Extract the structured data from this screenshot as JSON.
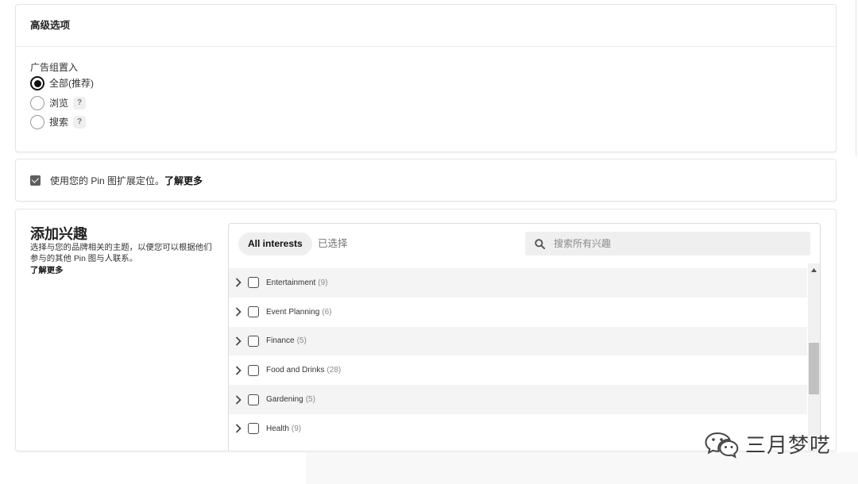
{
  "advanced_options": {
    "title": "高级选项",
    "placement": {
      "label": "广告组置入",
      "options": [
        {
          "label": "全部(推荐)",
          "selected": true
        },
        {
          "label": "浏览",
          "selected": false,
          "help": "?"
        },
        {
          "label": "搜索",
          "selected": false,
          "help": "?"
        }
      ]
    }
  },
  "expanded_targeting": {
    "checked": true,
    "text": "使用您的 Pin 图扩展定位。",
    "link": "了解更多"
  },
  "interests": {
    "title": "添加兴趣",
    "description_lines": [
      "选择与您的品牌相关的主题，以便您可以根据他们",
      "参与的其他 Pin 图与人联系。"
    ],
    "link": "了解更多",
    "tabs": [
      {
        "label": "All interests",
        "active": true
      },
      {
        "label": "已选择",
        "active": false
      }
    ],
    "search": {
      "placeholder": "搜索所有兴趣",
      "value": "",
      "icon": "search-icon"
    },
    "items": [
      {
        "name": "Entertainment",
        "count": "(9)",
        "checked": false
      },
      {
        "name": "Event Planning",
        "count": "(6)",
        "checked": false
      },
      {
        "name": "Finance",
        "count": "(5)",
        "checked": false
      },
      {
        "name": "Food and Drinks",
        "count": "(28)",
        "checked": false
      },
      {
        "name": "Gardening",
        "count": "(5)",
        "checked": false
      },
      {
        "name": "Health",
        "count": "(9)",
        "checked": false
      }
    ]
  },
  "watermark": {
    "icon": "wechat-icon",
    "text": "三月梦呓"
  },
  "theme": {
    "text": "#333333",
    "checkbox_checked": "#5f5f5f",
    "tab_active_bg": "#efefef",
    "search_bg": "#efefef",
    "row_alt_bg": "#f4f4f4",
    "scrollbar_thumb": "#c1c1c1"
  }
}
